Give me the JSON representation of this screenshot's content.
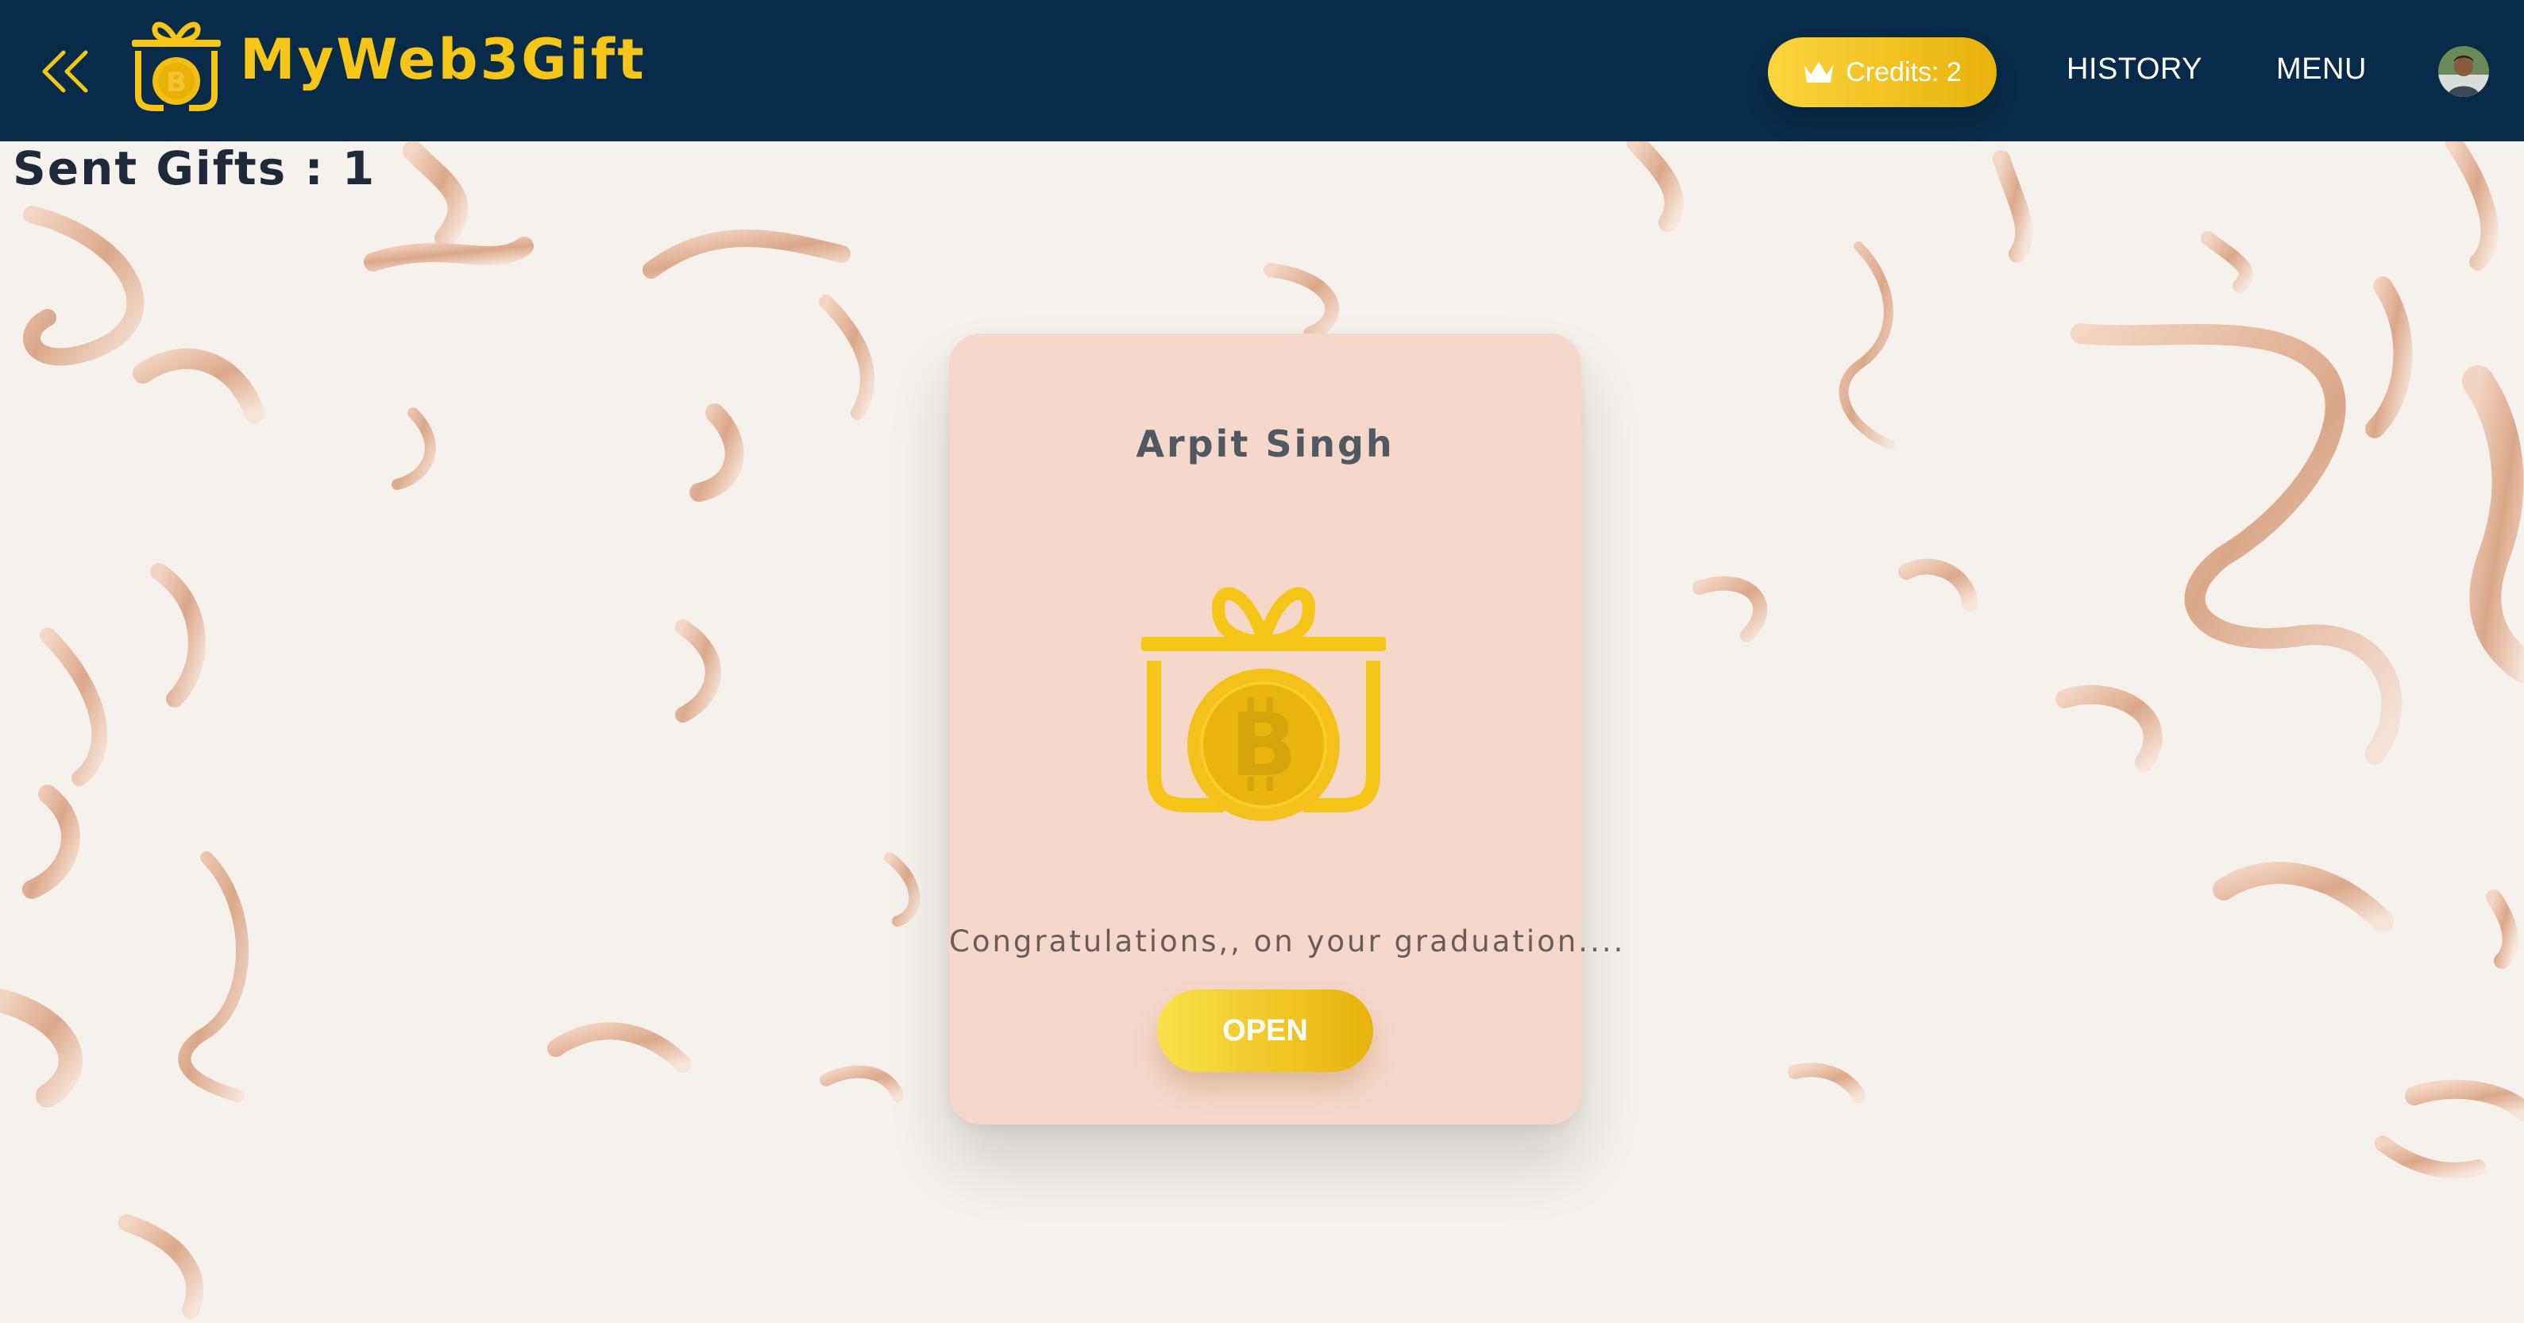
{
  "header": {
    "brand": "MyWeb3Gift",
    "credits_label": "Credits: 2",
    "nav": {
      "history": "HISTORY",
      "menu": "MENU"
    },
    "icons": {
      "back": "double-chevron-left-icon",
      "logo": "gift-bitcoin-logo",
      "credits": "crown-icon",
      "avatar": "user-avatar"
    }
  },
  "page": {
    "title": "Sent Gifts : 1"
  },
  "gift": {
    "sender": "Arpit Singh",
    "message": "Congratulations,, on your graduation....",
    "open_label": "OPEN",
    "icon": "gift-bitcoin-icon"
  },
  "colors": {
    "navbar": "#082b49",
    "brand_yellow": "#f5c518",
    "card": "#f5d8ca",
    "background": "#f5f1ec",
    "confetti": "#e3b59c"
  }
}
